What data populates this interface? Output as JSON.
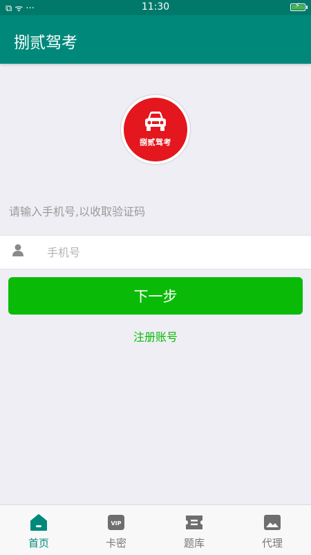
{
  "status_bar": {
    "time": "11:30",
    "left_icons": "⧉ ᯤ ···"
  },
  "app_bar": {
    "title": "捌贰驾考"
  },
  "logo": {
    "text": "捌贰驾考"
  },
  "login": {
    "hint": "请输入手机号,以收取验证码",
    "phone_placeholder": "手机号",
    "phone_value": "",
    "next_label": "下一步",
    "register_label": "注册账号"
  },
  "tabs": [
    {
      "label": "首页",
      "icon": "home-icon",
      "active": true
    },
    {
      "label": "卡密",
      "icon": "vip-icon",
      "active": false
    },
    {
      "label": "题库",
      "icon": "ticket-icon",
      "active": false
    },
    {
      "label": "代理",
      "icon": "image-icon",
      "active": false
    }
  ],
  "colors": {
    "primary": "#00897b",
    "status_bar": "#00796b",
    "accent_green": "#09bb07",
    "logo_red": "#e3171d",
    "tab_inactive": "#777777"
  }
}
